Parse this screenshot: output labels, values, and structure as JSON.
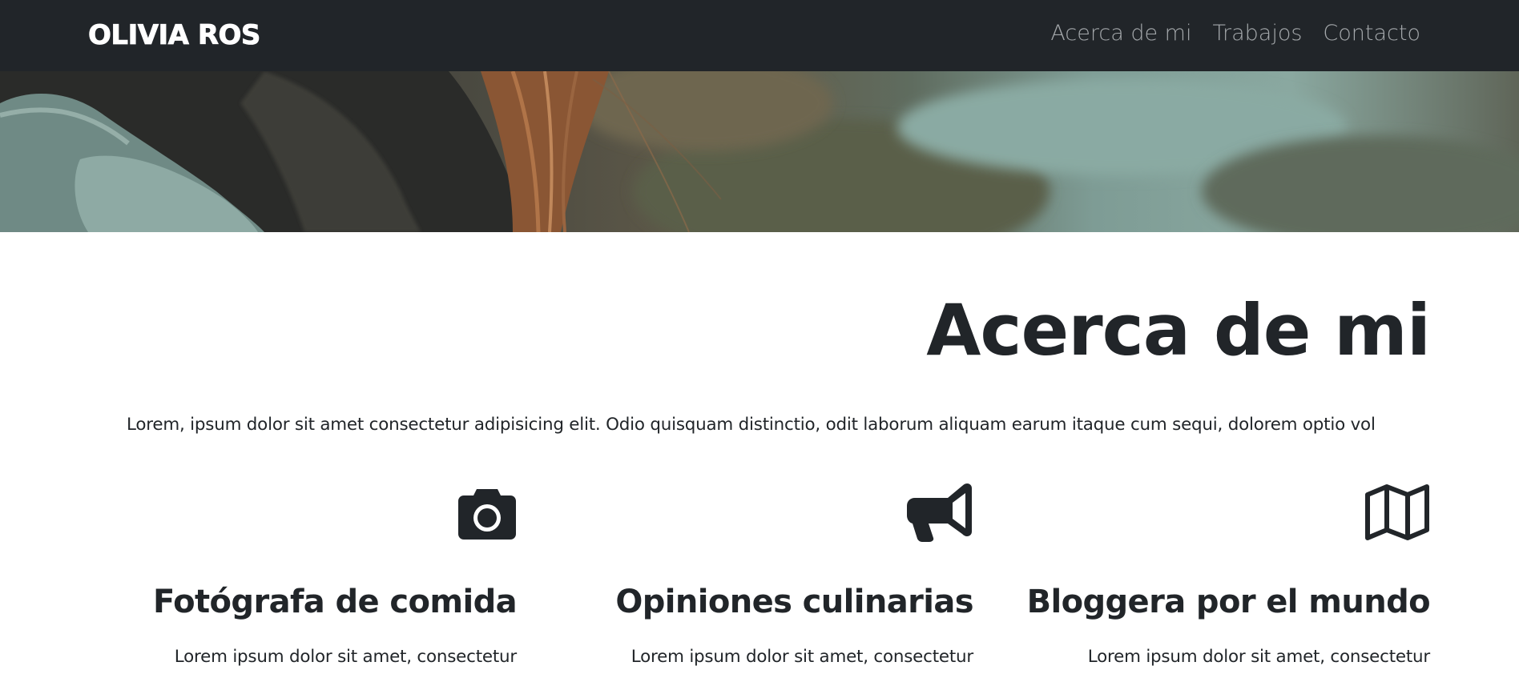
{
  "navbar": {
    "brand": "OLIVIA ROS",
    "links": [
      "Acerca de mi",
      "Trabajos",
      "Contacto"
    ]
  },
  "hero": {
    "image": "woman-hair-landscape-photo"
  },
  "about": {
    "title": "Acerca de mi",
    "text": "Lorem, ipsum dolor sit amet consectetur adipisicing elit. Odio quisquam distinctio, odit laborum aliquam earum itaque cum sequi, dolorem optio vol"
  },
  "features": [
    {
      "icon": "camera-icon",
      "title": "Fotógrafa de comida",
      "text": "Lorem ipsum dolor sit amet, consectetur"
    },
    {
      "icon": "megaphone-icon",
      "title": "Opiniones culinarias",
      "text": "Lorem ipsum dolor sit amet, consectetur"
    },
    {
      "icon": "map-icon",
      "title": "Bloggera por el mundo",
      "text": "Lorem ipsum dolor sit amet, consectetur"
    }
  ],
  "colors": {
    "navbar_bg": "#212529",
    "nav_link": "#a4a8ab",
    "text": "#212529"
  }
}
